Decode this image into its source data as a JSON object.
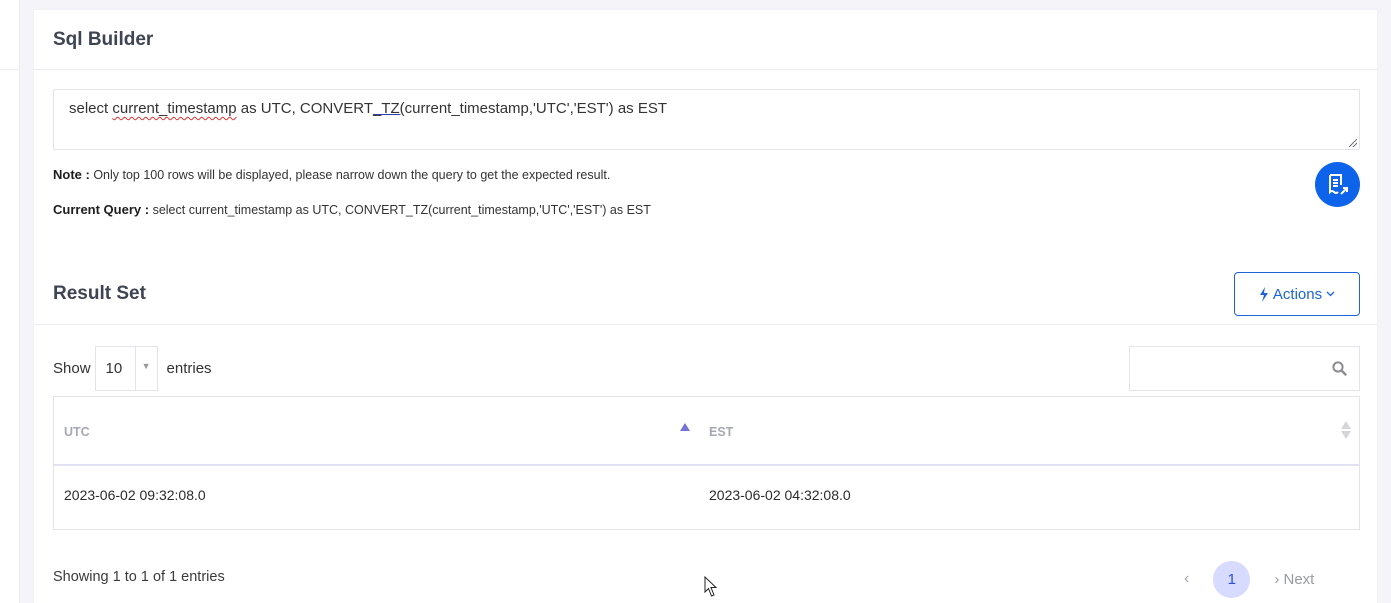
{
  "sql_builder": {
    "title": "Sql Builder",
    "query_text": {
      "part1": "select ",
      "part2": "current_timestamp",
      "part3": " as UTC, CONVERT",
      "part4": "_TZ(",
      "part5": "current_timestamp,'UTC','EST') as EST"
    },
    "note_label": "Note :",
    "note_text": "Only top 100 rows will be displayed, please narrow down the query to get the expected result.",
    "current_query_label": "Current Query :",
    "current_query_text": "select current_timestamp as UTC, CONVERT_TZ(current_timestamp,'UTC','EST') as EST",
    "fab_icon": "receipt-export-icon"
  },
  "result_set": {
    "title": "Result Set",
    "actions_label": "Actions",
    "actions_icon": "lightning-icon",
    "show_label": "Show",
    "page_length": "10",
    "entries_label": "entries",
    "search_value": "",
    "search_placeholder": "",
    "columns": [
      {
        "label": "UTC",
        "sort": "ascending"
      },
      {
        "label": "EST",
        "sort": "none"
      }
    ],
    "rows": [
      [
        "2023-06-02 09:32:08.0",
        "2023-06-02 04:32:08.0"
      ]
    ],
    "info": "Showing 1 to 1 of 1 entries",
    "pagination": {
      "prev": "‹",
      "current_page": "1",
      "next": "› Next"
    }
  },
  "colors": {
    "accent": "#0d63ea",
    "actions_border": "#1c64d8",
    "sort_active": "#7474d6",
    "page_active_bg": "#d6dbff"
  }
}
